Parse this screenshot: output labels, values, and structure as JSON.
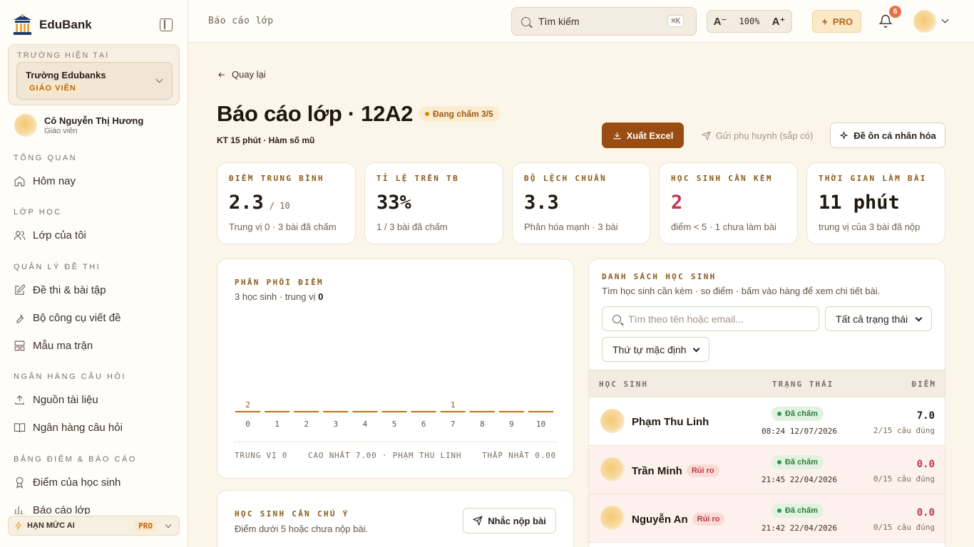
{
  "brand": {
    "name": "EduBank"
  },
  "school": {
    "caption": "TRƯỜNG HIỆN TẠI",
    "name": "Trường Edubanks",
    "role": "GIÁO VIÊN"
  },
  "user": {
    "name": "Cô Nguyễn Thị Hương",
    "role": "Giáo viên"
  },
  "sidebar": {
    "sections": [
      "TỔNG QUAN",
      "LỚP HỌC",
      "QUẢN LÝ ĐỀ THI",
      "NGÂN HÀNG CÂU HỎI",
      "BẢNG ĐIỂM & BÁO CÁO"
    ],
    "items": [
      {
        "label": "Hôm nay",
        "icon": "home-icon"
      },
      {
        "label": "Lớp của tôi",
        "icon": "users-icon"
      },
      {
        "label": "Đề thi & bài tập",
        "icon": "edit-icon"
      },
      {
        "label": "Bộ công cụ viết đề",
        "icon": "wrench-icon"
      },
      {
        "label": "Mẫu ma trận",
        "icon": "grid-icon"
      },
      {
        "label": "Nguồn tài liệu",
        "icon": "upload-icon"
      },
      {
        "label": "Ngân hàng câu hỏi",
        "icon": "book-icon"
      },
      {
        "label": "Điểm của học sinh",
        "icon": "award-icon"
      },
      {
        "label": "Báo cáo lớp",
        "icon": "chart-icon"
      }
    ],
    "ai_quota": {
      "label": "HẠN MỨC AI",
      "badge": "PRO"
    }
  },
  "topbar": {
    "breadcrumb": "Báo cáo lớp",
    "search_placeholder": "Tìm kiếm",
    "search_shortcut": "⌘K",
    "zoom_minus": "A⁻",
    "zoom_level": "100%",
    "zoom_plus": "A⁺",
    "pro_label": "PRO",
    "notification_count": "6"
  },
  "header": {
    "back_label": "Quay lại",
    "title": "Báo cáo lớp · 12A2",
    "status": "Đang chấm 3/5",
    "subtitle": "KT 15 phút · Hàm số mũ",
    "export_label": "Xuất Excel",
    "send_parent_label": "Gửi phụ huynh (sắp có)",
    "personal_review_label": "Đề ôn cá nhân hóa"
  },
  "stats": [
    {
      "caption": "ĐIỂM TRUNG BÌNH",
      "value": "2.3",
      "unit": "/ 10",
      "sub": "Trung vị 0 · 3 bài đã chấm"
    },
    {
      "caption": "TỈ LỆ TRÊN TB",
      "value": "33%",
      "sub": "1 / 3 bài đã chấm"
    },
    {
      "caption": "ĐỘ LỆCH CHUẨN",
      "value": "3.3",
      "sub": "Phân hóa mạnh · 3 bài"
    },
    {
      "caption": "HỌC SINH CẦN KÈM",
      "value": "2",
      "sub": "điểm < 5 · 1 chưa làm bài"
    },
    {
      "caption": "THỜI GIAN LÀM BÀI",
      "value": "11 phút",
      "sub": "trung vị của 3 bài đã nộp"
    }
  ],
  "distribution": {
    "caption": "PHÂN PHỐI ĐIỂM",
    "sub_prefix": "3 học sinh · trung vị ",
    "sub_median": "0",
    "footer": {
      "median": "TRUNG VỊ 0",
      "max": "CAO NHẤT 7.00 · PHẠM THU LINH",
      "min": "THẤP NHẤT 0.00"
    }
  },
  "chart_data": {
    "type": "bar",
    "categories": [
      "0",
      "1",
      "2",
      "3",
      "4",
      "5",
      "6",
      "7",
      "8",
      "9",
      "10"
    ],
    "values": [
      2,
      0,
      0,
      0,
      0,
      0,
      0,
      1,
      0,
      0,
      0
    ],
    "title": "PHÂN PHỐI ĐIỂM"
  },
  "attention": {
    "caption": "HỌC SINH CẦN CHÚ Ý",
    "sub": "Điểm dưới 5 hoặc chưa nộp bài.",
    "remind_label": "Nhắc nộp bài"
  },
  "students": {
    "caption": "DANH SÁCH HỌC SINH",
    "sub": "Tìm học sinh cần kèm · so điểm · bấm vào hàng để xem chi tiết bài.",
    "search_placeholder": "Tìm theo tên hoặc email...",
    "status_filter": "Tất cả trạng thái",
    "sort": "Thứ tự mặc định",
    "columns": [
      "HỌC SINH",
      "TRẠNG THÁI",
      "ĐIỂM"
    ],
    "rows": [
      {
        "name": "Phạm Thu Linh",
        "risk": "",
        "status": "Đã chấm",
        "time": "08:24 12/07/2026",
        "score": "7.0",
        "correct": "2/15 câu đúng"
      },
      {
        "name": "Trần Minh",
        "risk": "Rủi ro",
        "status": "Đã chấm",
        "time": "21:45 22/04/2026",
        "score": "0.0",
        "correct": "0/15 câu đúng"
      },
      {
        "name": "Nguyễn An",
        "risk": "Rủi ro",
        "status": "Đã chấm",
        "time": "21:42 22/04/2026",
        "score": "0.0",
        "correct": "0/15 câu đúng"
      }
    ]
  }
}
